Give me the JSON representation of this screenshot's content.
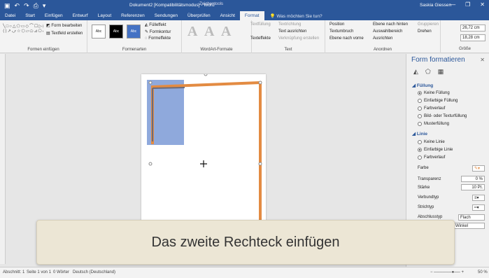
{
  "titlebar": {
    "title": "Dokument2 [Kompatibilitätsmodus] - Word",
    "context": "Zeichentools",
    "user": "Saskia Giessen",
    "minimize": "—",
    "restore": "❐",
    "close": "✕"
  },
  "tabs": [
    "Datei",
    "Start",
    "Einfügen",
    "Entwurf",
    "Layout",
    "Referenzen",
    "Sendungen",
    "Überprüfen",
    "Ansicht",
    "Format"
  ],
  "active_tab": "Format",
  "tellme": "Was möchten Sie tun?",
  "ribbon": {
    "insert_shapes": {
      "edit_shape": "Form bearbeiten",
      "textbox": "Textfeld erstellen",
      "label": "Formen einfügen"
    },
    "shape_styles": {
      "swatch1": "Abc",
      "swatch2": "Abc",
      "swatch3": "Abc",
      "fill": "Fülleffekt",
      "outline": "Formkontur",
      "effects": "Formeffekte",
      "label": "Formenarten"
    },
    "wordart": {
      "label": "WordArt-Formate",
      "a": "A"
    },
    "text": {
      "direction": "Textrichtung",
      "align": "Text ausrichten",
      "link": "Verknüpfung erstellen",
      "fill": "Textfüllung",
      "effects": "Texteffekte",
      "label": "Text"
    },
    "arrange": {
      "position": "Position",
      "wrap": "Textumbruch",
      "forward": "Ebene nach vorne",
      "backward": "Ebene nach hinten",
      "pane": "Auswahlbereich",
      "align": "Ausrichten",
      "group": "Gruppieren",
      "rotate": "Drehen",
      "label": "Anordnen"
    },
    "size": {
      "height": "26,72 cm",
      "width": "18,28 cm",
      "label": "Größe"
    }
  },
  "pane": {
    "title": "Form formatieren",
    "close": "✕",
    "fill_section": "Füllung",
    "fill_options": [
      "Keine Füllung",
      "Einfarbige Füllung",
      "Farbverlauf",
      "Bild- oder Texturfüllung",
      "Musterfüllung"
    ],
    "line_section": "Linie",
    "line_options": [
      "Keine Linie",
      "Einfarbige Linie",
      "Farbverlauf"
    ],
    "props": {
      "color": "Farbe",
      "transparency": "Transparenz",
      "transparency_value": "0 %",
      "width": "Stärke",
      "width_value": "10 Pt.",
      "compound": "Verbundtyp",
      "dash": "Strichtyp",
      "cap": "Abschlusstyp",
      "cap_value": "Flach",
      "join_value": "Winkel"
    }
  },
  "caption": "Das zweite Rechteck einfügen",
  "status": {
    "section": "Abschnitt: 1",
    "page": "Seite 1 von 1",
    "words": "0 Wörter",
    "language": "Deutsch (Deutschland)",
    "zoom": "50 %"
  },
  "colors": {
    "brand": "#2b579a",
    "orange": "#e38b42",
    "blue_shape": "#8fa9dc"
  }
}
